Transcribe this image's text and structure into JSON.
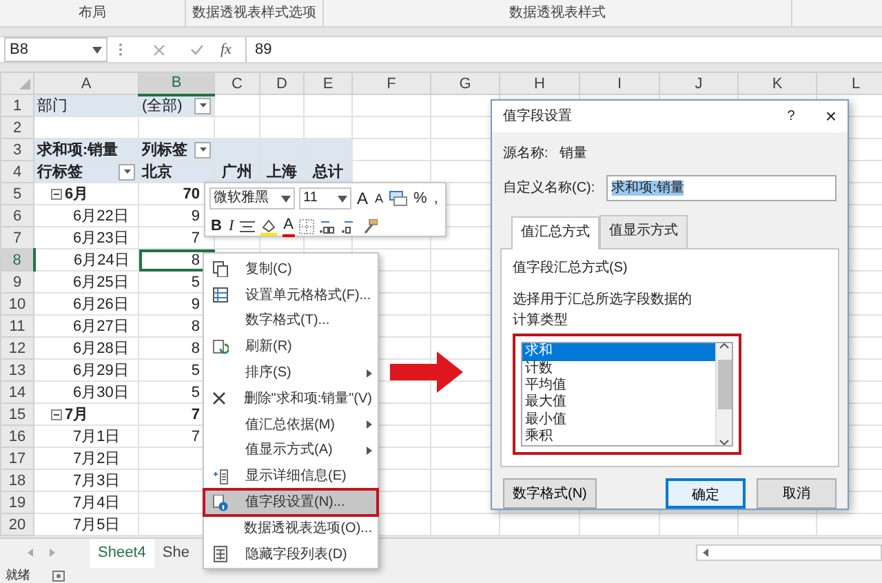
{
  "ribbon_groups": [
    "布局",
    "数据透视表样式选项",
    "数据透视表样式"
  ],
  "formula_bar": {
    "name_box": "B8",
    "function_label": "fx",
    "value": "89"
  },
  "columns": [
    {
      "label": "A",
      "selected": false
    },
    {
      "label": "B",
      "selected": true
    },
    {
      "label": "C",
      "selected": false
    },
    {
      "label": "D",
      "selected": false
    },
    {
      "label": "E",
      "selected": false
    },
    {
      "label": "F",
      "selected": false
    },
    {
      "label": "G",
      "selected": false
    },
    {
      "label": "H",
      "selected": false
    },
    {
      "label": "I",
      "selected": false
    },
    {
      "label": "J",
      "selected": false
    },
    {
      "label": "K",
      "selected": false
    },
    {
      "label": "L",
      "selected": false
    }
  ],
  "rows": [
    {
      "number": "1",
      "selected": false,
      "shaded": true,
      "cells": [
        {
          "text": "部门",
          "kind": "text"
        },
        {
          "text": "(全部)",
          "kind": "filter"
        }
      ]
    },
    {
      "number": "2",
      "selected": false,
      "shaded": false
    },
    {
      "number": "3",
      "selected": false,
      "shaded": true,
      "cells": [
        {
          "text": "求和项:销量",
          "kind": "bold"
        },
        {
          "text": "列标签",
          "kind": "bold_filter"
        }
      ]
    },
    {
      "number": "4",
      "selected": false,
      "shaded": true,
      "cells": [
        {
          "text": "行标签",
          "kind": "bold_filter"
        },
        {
          "text": "北京",
          "kind": "bold"
        },
        {
          "text": "广州",
          "kind": "bold"
        },
        {
          "text": "上海",
          "kind": "bold"
        },
        {
          "text": "总计",
          "kind": "bold"
        }
      ]
    },
    {
      "number": "5",
      "selected": false,
      "shaded": false,
      "cells": [
        {
          "text": "6月",
          "kind": "group",
          "expanded": true
        },
        {
          "text": "70",
          "kind": "total"
        }
      ]
    },
    {
      "number": "6",
      "selected": false,
      "shaded": false,
      "cells": [
        {
          "text": "6月22日",
          "kind": "date"
        },
        {
          "text": "9",
          "kind": "number"
        }
      ]
    },
    {
      "number": "7",
      "selected": false,
      "shaded": false,
      "cells": [
        {
          "text": "6月23日",
          "kind": "date"
        },
        {
          "text": "7",
          "kind": "number"
        }
      ]
    },
    {
      "number": "8",
      "selected": true,
      "shaded": false,
      "cells": [
        {
          "text": "6月24日",
          "kind": "date"
        },
        {
          "text": "8",
          "kind": "number"
        }
      ]
    },
    {
      "number": "9",
      "selected": false,
      "shaded": false,
      "cells": [
        {
          "text": "6月25日",
          "kind": "date"
        },
        {
          "text": "5",
          "kind": "number"
        }
      ]
    },
    {
      "number": "10",
      "selected": false,
      "shaded": false,
      "cells": [
        {
          "text": "6月26日",
          "kind": "date"
        },
        {
          "text": "9",
          "kind": "number"
        }
      ]
    },
    {
      "number": "11",
      "selected": false,
      "shaded": false,
      "cells": [
        {
          "text": "6月27日",
          "kind": "date"
        },
        {
          "text": "8",
          "kind": "number"
        }
      ]
    },
    {
      "number": "12",
      "selected": false,
      "shaded": false,
      "cells": [
        {
          "text": "6月28日",
          "kind": "date"
        },
        {
          "text": "8",
          "kind": "number"
        }
      ]
    },
    {
      "number": "13",
      "selected": false,
      "shaded": false,
      "cells": [
        {
          "text": "6月29日",
          "kind": "date"
        },
        {
          "text": "5",
          "kind": "number"
        }
      ]
    },
    {
      "number": "14",
      "selected": false,
      "shaded": false,
      "cells": [
        {
          "text": "6月30日",
          "kind": "date"
        },
        {
          "text": "5",
          "kind": "number"
        }
      ]
    },
    {
      "number": "15",
      "selected": false,
      "shaded": false,
      "cells": [
        {
          "text": "7月",
          "kind": "group",
          "expanded": true
        },
        {
          "text": "7",
          "kind": "total"
        }
      ]
    },
    {
      "number": "16",
      "selected": false,
      "shaded": false,
      "cells": [
        {
          "text": "7月1日",
          "kind": "date"
        },
        {
          "text": "7",
          "kind": "number"
        }
      ]
    },
    {
      "number": "17",
      "selected": false,
      "shaded": false,
      "cells": [
        {
          "text": "7月2日",
          "kind": "date"
        }
      ]
    },
    {
      "number": "18",
      "selected": false,
      "shaded": false,
      "cells": [
        {
          "text": "7月3日",
          "kind": "date"
        }
      ]
    },
    {
      "number": "19",
      "selected": false,
      "shaded": false,
      "cells": [
        {
          "text": "7月4日",
          "kind": "date"
        }
      ]
    },
    {
      "number": "20",
      "selected": false,
      "shaded": false,
      "cells": [
        {
          "text": "7月5日",
          "kind": "date"
        }
      ]
    }
  ],
  "mini_toolbar": {
    "font": "微软雅黑",
    "size": "11",
    "grow_font": "A",
    "shrink_font": "A",
    "percent": "%",
    "comma": ",",
    "bold": "B",
    "italic": "I",
    "font_color": "A"
  },
  "context_menu": [
    {
      "label": "复制(C)",
      "kind": "copy",
      "highlighted": false
    },
    {
      "label": "设置单元格格式(F)...",
      "kind": "format",
      "highlighted": false
    },
    {
      "label": "数字格式(T)...",
      "kind": "plain",
      "highlighted": false
    },
    {
      "label": "刷新(R)",
      "kind": "refresh",
      "highlighted": false
    },
    {
      "label": "排序(S)",
      "kind": "submenu",
      "highlighted": false
    },
    {
      "label": "删除\"求和项:销量\"(V)",
      "kind": "delete",
      "highlighted": false
    },
    {
      "label": "值汇总依据(M)",
      "kind": "submenu",
      "highlighted": false
    },
    {
      "label": "值显示方式(A)",
      "kind": "submenu",
      "highlighted": false
    },
    {
      "label": "显示详细信息(E)",
      "kind": "details",
      "highlighted": false
    },
    {
      "label": "值字段设置(N)...",
      "kind": "settings",
      "highlighted": true
    },
    {
      "label": "数据透视表选项(O)...",
      "kind": "plain",
      "highlighted": false
    },
    {
      "label": "隐藏字段列表(D)",
      "kind": "list",
      "highlighted": false
    }
  ],
  "dialog": {
    "title": "值字段设置",
    "help": "?",
    "close": "×",
    "source_label": "源名称:",
    "source_value": "销量",
    "custom_label": "自定义名称(C):",
    "custom_value": "求和项:销量",
    "tabs": [
      {
        "label": "值汇总方式",
        "selected": true
      },
      {
        "label": "值显示方式",
        "selected": false
      }
    ],
    "section_label": "值字段汇总方式(S)",
    "hint_lines": [
      "选择用于汇总所选字段数据的",
      "计算类型"
    ],
    "list": [
      {
        "label": "求和",
        "selected": true
      },
      {
        "label": "计数",
        "selected": false
      },
      {
        "label": "平均值",
        "selected": false
      },
      {
        "label": "最大值",
        "selected": false
      },
      {
        "label": "最小值",
        "selected": false
      },
      {
        "label": "乘积",
        "selected": false
      }
    ],
    "buttons": [
      {
        "label": "数字格式(N)",
        "kind": "plain"
      },
      {
        "label": "确定",
        "kind": "default"
      },
      {
        "label": "取消",
        "kind": "plain"
      }
    ]
  },
  "sheet_tabs": [
    {
      "label": "Sheet4",
      "selected": true
    },
    {
      "label": "She",
      "selected": false
    }
  ],
  "status_bar": {
    "text": "就绪"
  }
}
